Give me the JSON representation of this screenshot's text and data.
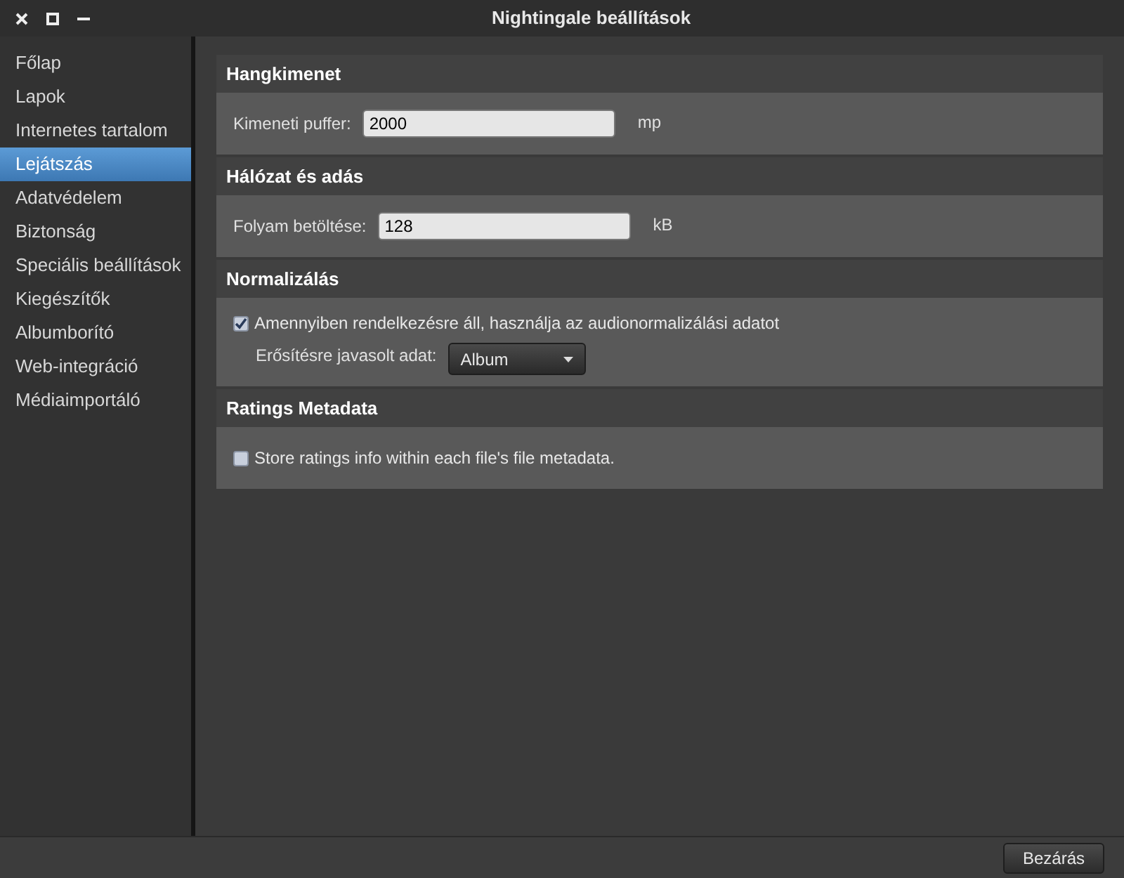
{
  "window": {
    "title": "Nightingale beállítások"
  },
  "sidebar": {
    "items": [
      {
        "label": "Főlap",
        "selected": false
      },
      {
        "label": "Lapok",
        "selected": false
      },
      {
        "label": "Internetes tartalom",
        "selected": false
      },
      {
        "label": "Lejátszás",
        "selected": true
      },
      {
        "label": "Adatvédelem",
        "selected": false
      },
      {
        "label": "Biztonság",
        "selected": false
      },
      {
        "label": "Speciális beállítások",
        "selected": false
      },
      {
        "label": "Kiegészítők",
        "selected": false
      },
      {
        "label": "Albumborító",
        "selected": false
      },
      {
        "label": "Web-integráció",
        "selected": false
      },
      {
        "label": "Médiaimportáló",
        "selected": false
      }
    ]
  },
  "sections": [
    {
      "title": "Hangkimenet",
      "rows": [
        {
          "kind": "field",
          "label": "Kimeneti puffer:",
          "value": "2000",
          "unit": "mp"
        }
      ]
    },
    {
      "title": "Hálózat és adás",
      "rows": [
        {
          "kind": "field",
          "label": "Folyam betöltése:",
          "value": "128",
          "unit": "kB"
        }
      ]
    },
    {
      "title": "Normalizálás",
      "rows": [
        {
          "kind": "checkbox",
          "label": "Amennyiben rendelkezésre áll, használja az audionormalizálási adatot",
          "checked": true
        },
        {
          "kind": "select",
          "label": "Erősítésre javasolt adat:",
          "value": "Album"
        }
      ]
    },
    {
      "title": "Ratings Metadata",
      "rows": [
        {
          "kind": "checkbox",
          "label": "Store ratings info within each file's file metadata.",
          "checked": false
        }
      ]
    }
  ],
  "buttons": [
    {
      "label": "Bezárás"
    }
  ]
}
